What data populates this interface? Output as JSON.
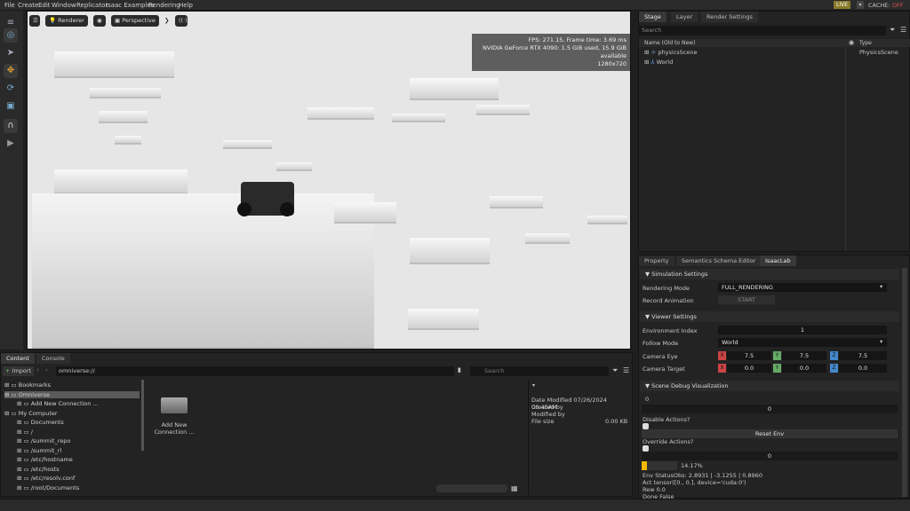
{
  "menu": [
    "File",
    "Create",
    "Edit",
    "Window",
    "Replicator",
    "Isaac Examples",
    "Rendering",
    "Help"
  ],
  "top_right": {
    "live": "LIVE",
    "cache_label": "CACHE:",
    "cache_state": "OFF"
  },
  "viewport": {
    "renderer_label": "Renderer",
    "perspective_label": "Perspective",
    "hud": {
      "fps_line": "FPS: 271.15, Frame time: 3.69 ms",
      "gpu_line": "NVIDIA GeForce RTX 4090: 1.5 GiB used, 15.9 GiB available",
      "res_line": "1280x720"
    }
  },
  "stage": {
    "tabs": [
      "Stage",
      "Layer",
      "Render Settings"
    ],
    "search_placeholder": "Search",
    "col_name": "Name (Old to New)",
    "col_type": "Type",
    "items": [
      {
        "name": "physicsScene",
        "type": "PhysicsScene"
      },
      {
        "name": "World",
        "type": ""
      }
    ]
  },
  "props": {
    "tabs": [
      "Property",
      "Semantics Schema Editor",
      "IsaacLab"
    ],
    "sim_settings": "Simulation Settings",
    "rendering_mode_label": "Rendering Mode",
    "rendering_mode": "FULL_RENDERING",
    "record_label": "Record Animation",
    "start": "START",
    "viewer_settings": "Viewer Settings",
    "env_index_label": "Environment Index",
    "env_index": "1",
    "follow_label": "Follow Mode",
    "follow_value": "World",
    "cam_eye_label": "Camera Eye",
    "cam_eye": [
      "7.5",
      "7.5",
      "7.5"
    ],
    "cam_target_label": "Camera Target",
    "cam_target": [
      "0.0",
      "0.0",
      "0.0"
    ],
    "axis": [
      "X",
      "Y",
      "Z"
    ],
    "debug": "Scene Debug Visualization",
    "val_a": "0",
    "val_b": "0",
    "disable_label": "Disable Actions?",
    "reset": "Reset Env",
    "override_label": "Override Actions?",
    "val_c": "0",
    "progress_text": "14.17%",
    "progress": 0.1417,
    "status_line1": "Env StatusObs: 2.8931 | -3.1255 | 0.8960",
    "status_line2": "Act tensor([0., 0.], device='cuda:0')",
    "status_line3": "Rew 0.0",
    "status_line4": "Done False"
  },
  "content": {
    "tabs": [
      "Content",
      "Console"
    ],
    "import": "Import",
    "path": "omniverse://",
    "search": "Search",
    "tree": [
      {
        "label": "Bookmarks",
        "indent": 0
      },
      {
        "label": "Omniverse",
        "indent": 0
      },
      {
        "label": "Add New Connection ...",
        "indent": 1
      },
      {
        "label": "My Computer",
        "indent": 0
      },
      {
        "label": "Documents",
        "indent": 1
      },
      {
        "label": "/",
        "indent": 1
      },
      {
        "label": "/summit_repo",
        "indent": 1
      },
      {
        "label": "/summit_rl",
        "indent": 1
      },
      {
        "label": "/etc/hostname",
        "indent": 1
      },
      {
        "label": "/etc/hosts",
        "indent": 1
      },
      {
        "label": "/etc/resolv.conf",
        "indent": 1
      },
      {
        "label": "/root/Documents",
        "indent": 1
      }
    ],
    "tile_label": "Add New Connection ...",
    "info": {
      "date_line": "Date Modified 07/26/2024 06:45AM",
      "created": "Created by",
      "modified": "Modified by",
      "filesize_label": "File size",
      "filesize": "0.00 KB"
    }
  }
}
